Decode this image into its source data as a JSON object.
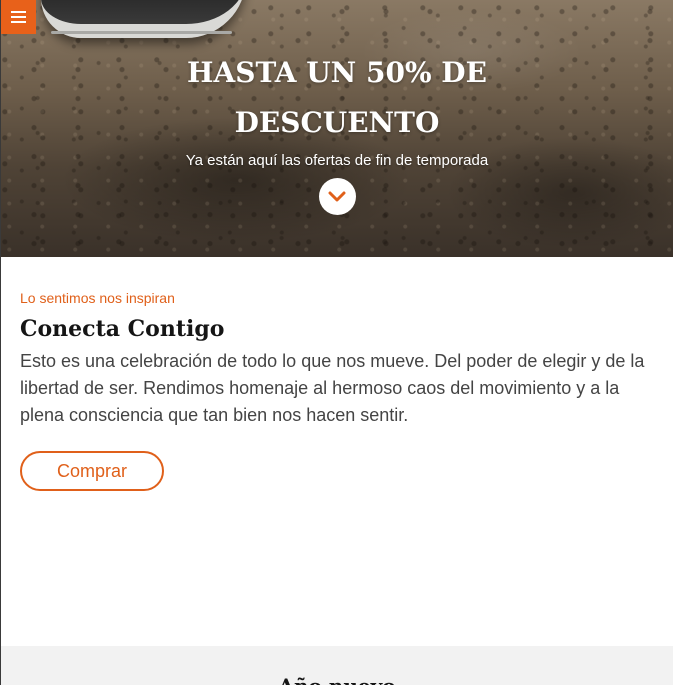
{
  "hero": {
    "title": "HASTA UN 50% DE DESCUENTO",
    "subtitle": "Ya están aquí las ofertas de fin de temporada",
    "menu_icon": "hamburger-menu-icon",
    "scroll_icon": "chevron-down-icon"
  },
  "section": {
    "eyebrow": "Lo sentimos nos inspiran",
    "title": "Conecta Contigo",
    "body": "Esto es una celebración de todo lo que nos mueve. Del poder de elegir y de la libertad de ser. Rendimos homenaje al hermoso caos del movimiento y a la plena consciencia que tan bien nos hacen sentir.",
    "button_label": "Comprar"
  },
  "next_section": {
    "title": "Año nuevo"
  },
  "colors": {
    "accent": "#e0601a",
    "menu_bg": "#e8611a",
    "text_dark": "#151515",
    "text_body": "#444444",
    "section_bg": "#f2f2f2"
  }
}
